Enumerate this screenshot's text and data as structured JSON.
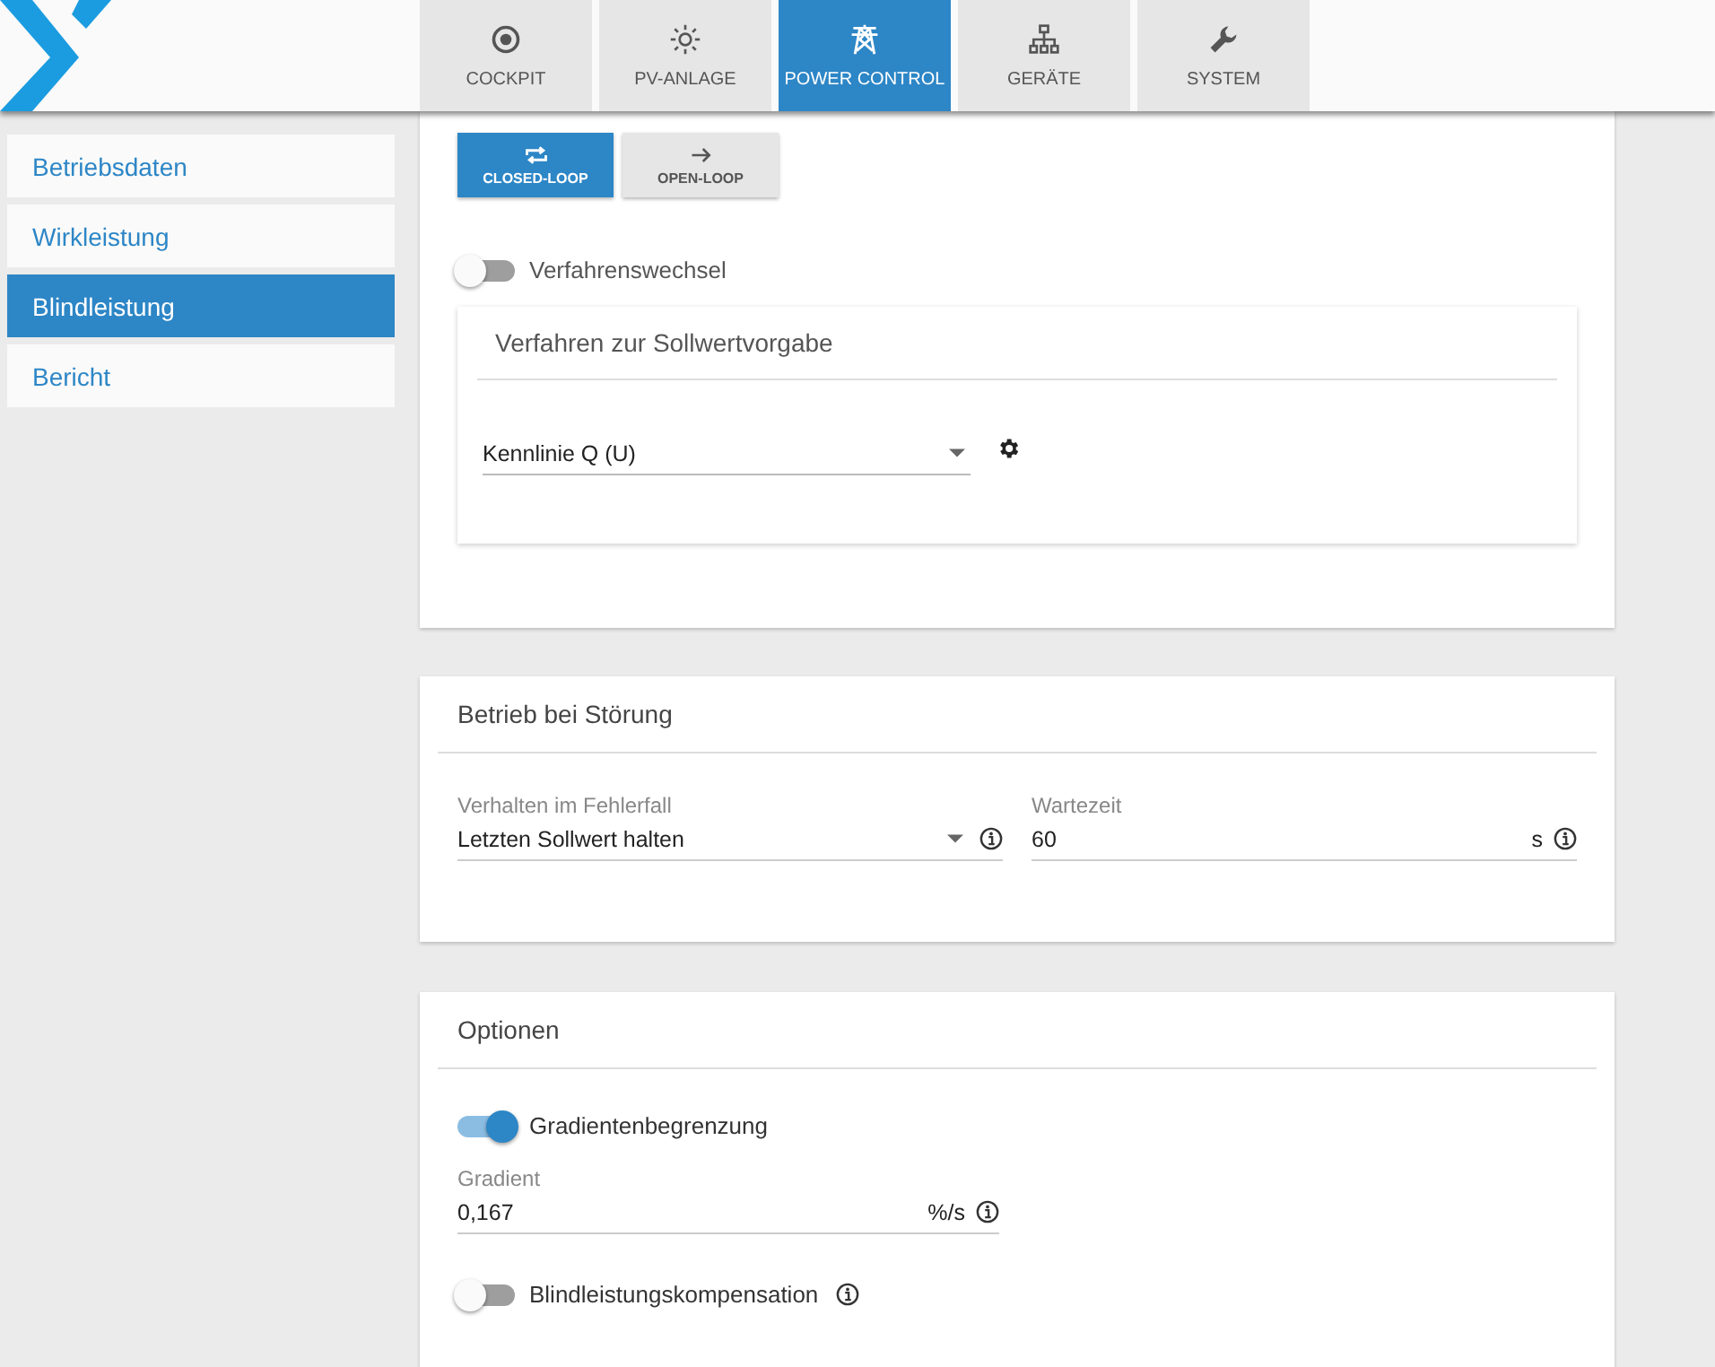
{
  "tabs": [
    {
      "label": "COCKPIT",
      "selected": false
    },
    {
      "label": "PV-ANLAGE",
      "selected": false
    },
    {
      "label": "POWER CONTROL",
      "selected": true
    },
    {
      "label": "GERÄTE",
      "selected": false
    },
    {
      "label": "SYSTEM",
      "selected": false
    }
  ],
  "sidebar": {
    "items": [
      {
        "label": "Betriebsdaten",
        "selected": false
      },
      {
        "label": "Wirkleistung",
        "selected": false
      },
      {
        "label": "Blindleistung",
        "selected": true
      },
      {
        "label": "Bericht",
        "selected": false
      }
    ]
  },
  "mode_buttons": [
    {
      "label": "CLOSED-LOOP",
      "selected": true
    },
    {
      "label": "OPEN-LOOP",
      "selected": false
    }
  ],
  "switch_toggle": {
    "label": "Verfahrenswechsel",
    "on": false
  },
  "setpoint_card": {
    "title": "Verfahren zur Sollwertvorgabe",
    "select": {
      "value": "Kennlinie Q (U)"
    }
  },
  "fault_card": {
    "title": "Betrieb bei Störung",
    "behavior": {
      "label": "Verhalten im Fehlerfall",
      "value": "Letzten Sollwert halten"
    },
    "wait": {
      "label": "Wartezeit",
      "value": "60",
      "unit": "s"
    }
  },
  "options_card": {
    "title": "Optionen",
    "gradient_toggle": {
      "label": "Gradientenbegrenzung",
      "on": true
    },
    "gradient": {
      "label": "Gradient",
      "value": "0,167",
      "unit": "%/s"
    },
    "compensation_toggle": {
      "label": "Blindleistungskompensation",
      "on": false
    }
  }
}
